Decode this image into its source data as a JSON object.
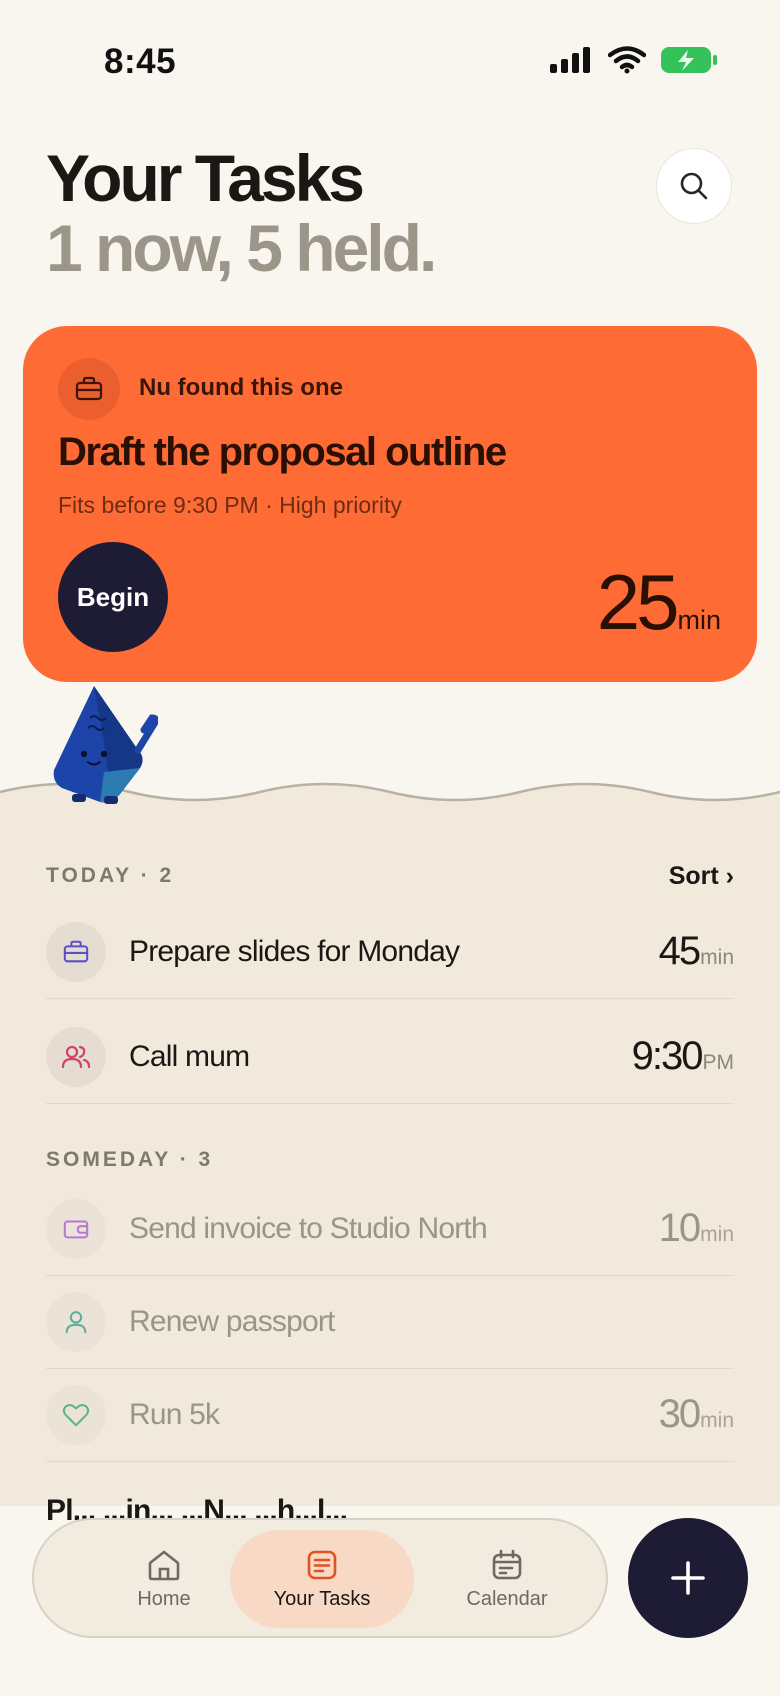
{
  "status_bar": {
    "time": "8:45"
  },
  "header": {
    "title": "Your Tasks",
    "subtitle": "1 now, 5 held."
  },
  "hero": {
    "badge": "Nu found this one",
    "title": "Draft the proposal outline",
    "meta": "Fits before 9:30 PM · High priority",
    "begin_label": "Begin",
    "duration_value": "25",
    "duration_unit": "min",
    "icon": "briefcase-icon",
    "color": "#ff6b35"
  },
  "today": {
    "label": "TODAY · 2",
    "sort_label": "Sort ›",
    "tasks": [
      {
        "title": "Prepare slides for Monday",
        "time_value": "45",
        "time_unit": "min",
        "icon": "briefcase-icon",
        "icon_color": "#5b4fc9"
      },
      {
        "title": "Call mum",
        "time_value": "9:30",
        "time_unit": "PM",
        "icon": "people-icon",
        "icon_color": "#d0436a"
      }
    ]
  },
  "someday": {
    "label": "SOMEDAY · 3",
    "tasks": [
      {
        "title": "Send invoice to Studio North",
        "time_value": "10",
        "time_unit": "min",
        "icon": "wallet-icon",
        "icon_color": "#b678d6"
      },
      {
        "title": "Renew passport",
        "time_value": "",
        "time_unit": "",
        "icon": "person-icon",
        "icon_color": "#5fae97"
      },
      {
        "title": "Run 5k",
        "time_value": "30",
        "time_unit": "min",
        "icon": "heart-icon",
        "icon_color": "#5fb58a"
      }
    ],
    "cut_off_text": "Pl... ...in... ...N... ...h...l..."
  },
  "nav": {
    "items": [
      {
        "label": "Home",
        "icon": "home-icon"
      },
      {
        "label": "Your Tasks",
        "icon": "tasks-icon",
        "active": true
      },
      {
        "label": "Calendar",
        "icon": "calendar-icon"
      }
    ]
  },
  "fab": {
    "icon": "plus-icon"
  }
}
